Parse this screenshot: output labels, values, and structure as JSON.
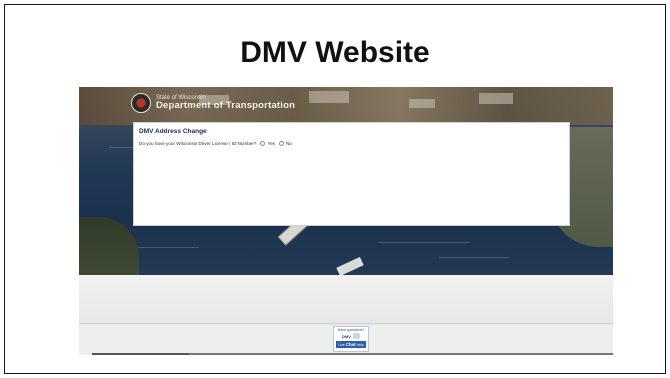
{
  "slide": {
    "title": "DMV Website"
  },
  "site": {
    "state_label": "State of Wisconsin",
    "department": "Department of Transportation"
  },
  "form": {
    "heading": "DMV Address Change",
    "question": "Do you have your Wisconsin Driver License / ID Number?",
    "options": [
      "Yes",
      "No"
    ],
    "selected": null
  },
  "chat": {
    "question": "Have questions?",
    "brand": "DMV",
    "button_prefix": "Live",
    "button_main": "Chat",
    "button_suffix": "Help"
  },
  "colors": {
    "form_heading": "#1d2a52",
    "chat_button": "#2c5fa8"
  }
}
